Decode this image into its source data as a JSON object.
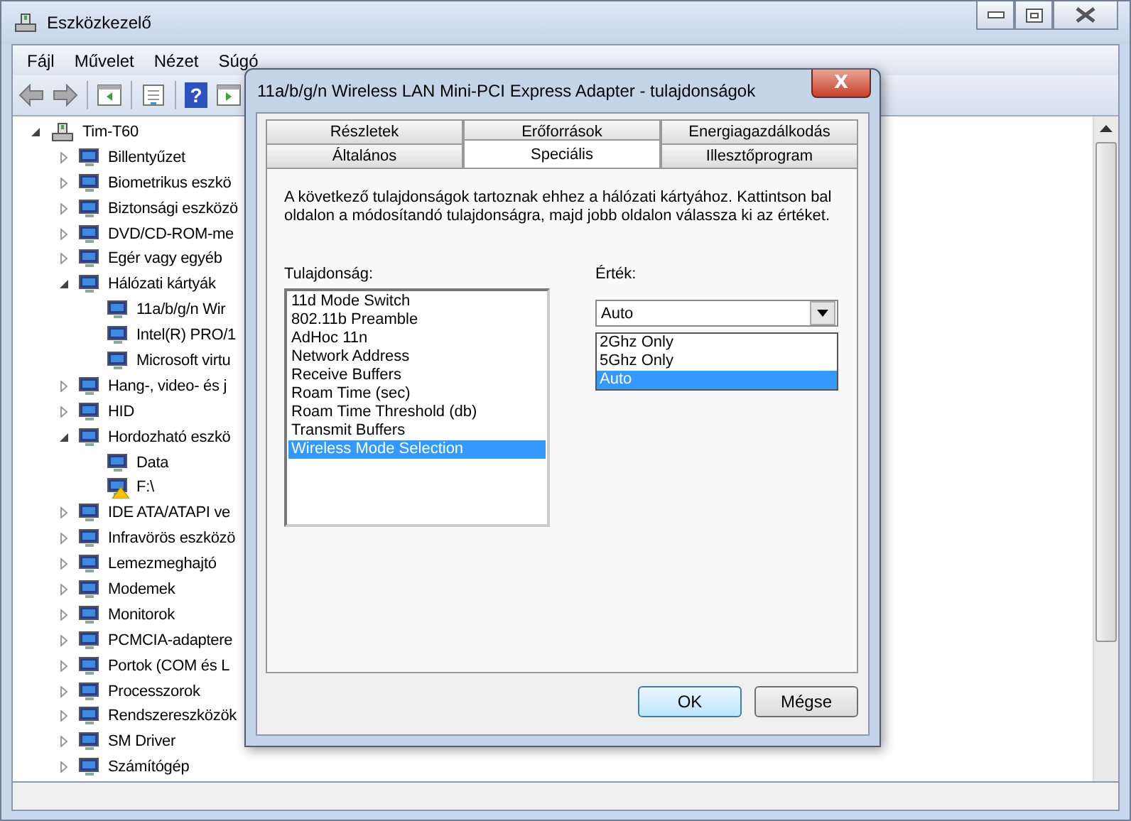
{
  "window": {
    "title": "Eszközkezelő"
  },
  "menu": [
    "Fájl",
    "Művelet",
    "Nézet",
    "Súgó"
  ],
  "toolbar": {
    "help_glyph": "?"
  },
  "tree": {
    "label": "Tim-T60",
    "expanded": true,
    "children": [
      {
        "label": "Billentyűzet",
        "expanded": false
      },
      {
        "label": "Biometrikus eszkö",
        "expanded": false
      },
      {
        "label": "Biztonsági eszközö",
        "expanded": false
      },
      {
        "label": "DVD/CD-ROM-me",
        "expanded": false
      },
      {
        "label": "Egér vagy egyéb",
        "expanded": false
      },
      {
        "label": "Hálózati kártyák",
        "expanded": true,
        "children": [
          {
            "label": "11a/b/g/n Wir"
          },
          {
            "label": "Intel(R) PRO/1"
          },
          {
            "label": "Microsoft virtu"
          }
        ]
      },
      {
        "label": "Hang-, video- és j",
        "expanded": false
      },
      {
        "label": "HID",
        "expanded": false
      },
      {
        "label": "Hordozható eszkö",
        "expanded": true,
        "children": [
          {
            "label": "Data",
            "warning": false
          },
          {
            "label": "F:\\",
            "warning": true
          }
        ]
      },
      {
        "label": "IDE ATA/ATAPI ve",
        "expanded": false
      },
      {
        "label": "Infravörös eszközö",
        "expanded": false
      },
      {
        "label": "Lemezmeghajtó",
        "expanded": false
      },
      {
        "label": "Modemek",
        "expanded": false
      },
      {
        "label": "Monitorok",
        "expanded": false
      },
      {
        "label": "PCMCIA-adaptere",
        "expanded": false
      },
      {
        "label": "Portok (COM és L",
        "expanded": false
      },
      {
        "label": "Processzorok",
        "expanded": false
      },
      {
        "label": "Rendszereszközök",
        "expanded": false
      },
      {
        "label": "SM Driver",
        "expanded": false
      },
      {
        "label": "Számítógép",
        "expanded": false
      }
    ]
  },
  "dialog": {
    "title": "11a/b/g/n Wireless LAN Mini-PCI Express Adapter - tulajdonságok",
    "close_glyph": "X",
    "tab_rows": [
      [
        {
          "label": "Részletek",
          "selected": false
        },
        {
          "label": "Erőforrások",
          "selected": false
        },
        {
          "label": "Energiagazdálkodás",
          "selected": false
        }
      ],
      [
        {
          "label": "Általános",
          "selected": false
        },
        {
          "label": "Speciális",
          "selected": true
        },
        {
          "label": "Illesztőprogram",
          "selected": false
        }
      ]
    ],
    "description": "A következő tulajdonságok tartoznak ehhez a hálózati kártyához. Kattintson bal oldalon a módosítandó tulajdonságra, majd jobb oldalon válassza ki az értéket.",
    "property_label": "Tulajdonság:",
    "properties": [
      {
        "label": "11d Mode Switch",
        "selected": false
      },
      {
        "label": "802.11b Preamble",
        "selected": false
      },
      {
        "label": "AdHoc 11n",
        "selected": false
      },
      {
        "label": "Network Address",
        "selected": false
      },
      {
        "label": "Receive Buffers",
        "selected": false
      },
      {
        "label": "Roam Time (sec)",
        "selected": false
      },
      {
        "label": "Roam Time Threshold (db)",
        "selected": false
      },
      {
        "label": "Transmit Buffers",
        "selected": false
      },
      {
        "label": "Wireless Mode Selection",
        "selected": true
      }
    ],
    "value_label": "Érték:",
    "value": "Auto",
    "options": [
      {
        "label": "2Ghz Only",
        "selected": false
      },
      {
        "label": "5Ghz Only",
        "selected": false
      },
      {
        "label": "Auto",
        "selected": true
      }
    ],
    "buttons": [
      {
        "label": "OK",
        "default": true
      },
      {
        "label": "Mégse",
        "default": false
      }
    ]
  }
}
